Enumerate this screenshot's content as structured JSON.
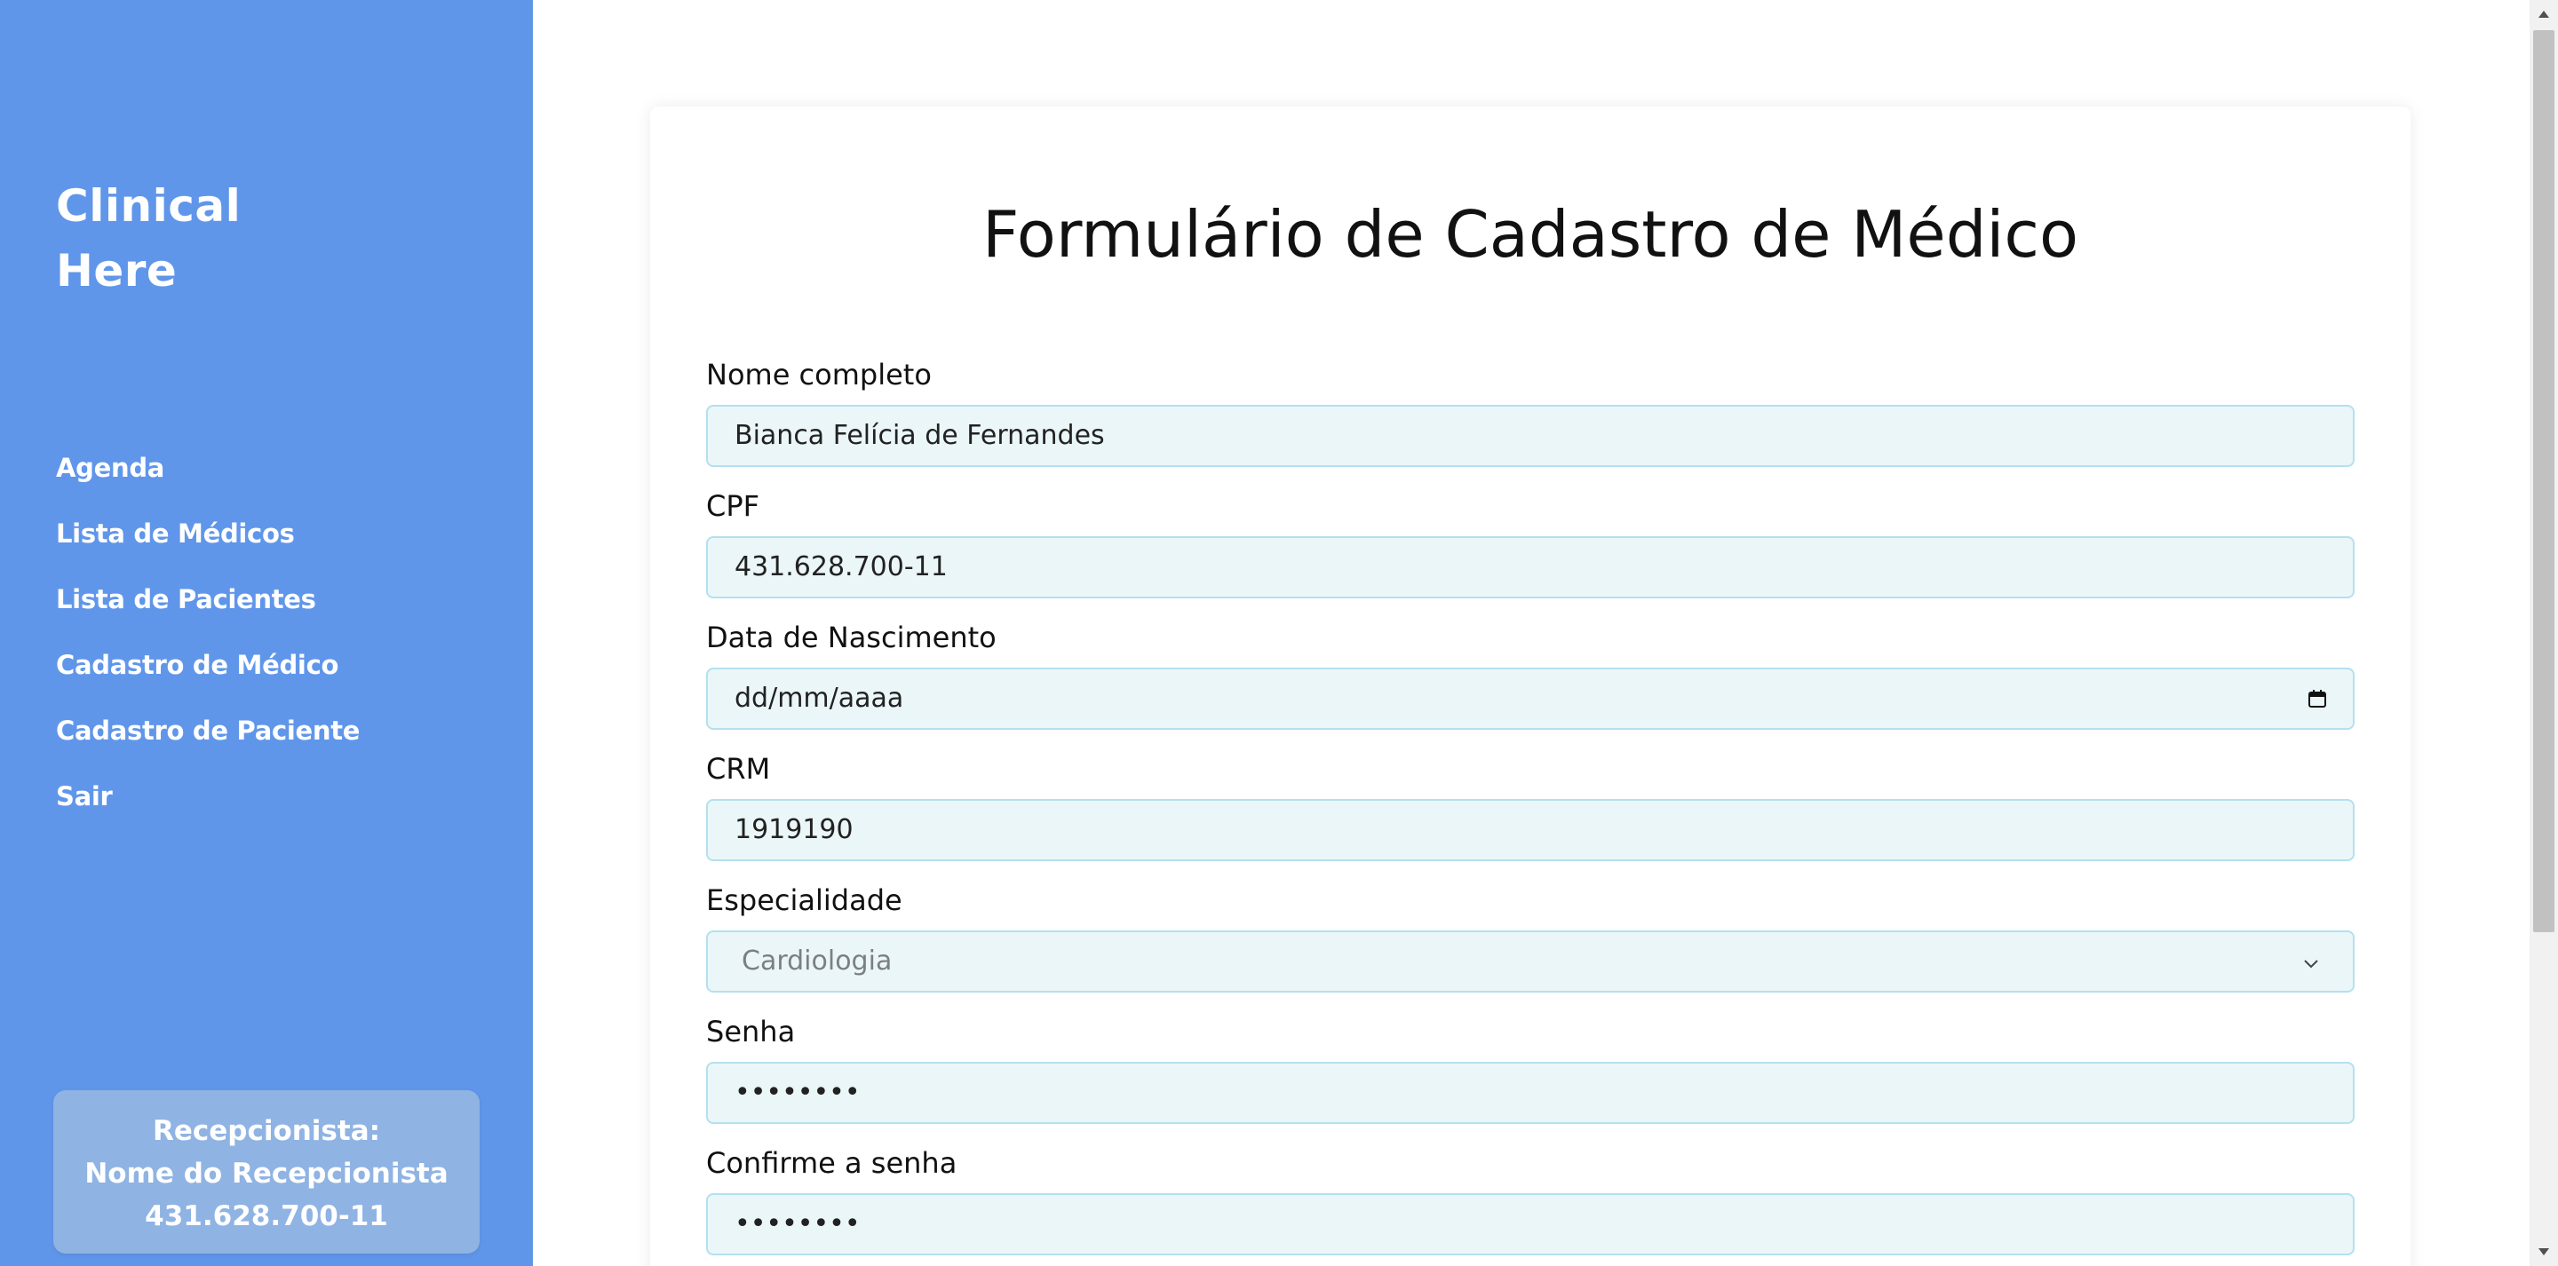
{
  "sidebar": {
    "brand_line1": "Clinical",
    "brand_line2": "Here",
    "nav": [
      {
        "label": "Agenda"
      },
      {
        "label": "Lista de Médicos"
      },
      {
        "label": "Lista de Pacientes"
      },
      {
        "label": "Cadastro de Médico"
      },
      {
        "label": "Cadastro de Paciente"
      },
      {
        "label": "Sair"
      }
    ],
    "user": {
      "role": "Recepcionista:",
      "name": "Nome do Recepcionista",
      "cpf": "431.628.700-11"
    }
  },
  "form": {
    "title": "Formulário de Cadastro de Médico",
    "fields": {
      "nome": {
        "label": "Nome completo",
        "value": "Bianca Felícia de Fernandes"
      },
      "cpf": {
        "label": "CPF",
        "value": "431.628.700-11"
      },
      "nascimento": {
        "label": "Data de Nascimento",
        "value": "dd/mm/aaaa"
      },
      "crm": {
        "label": "CRM",
        "value": "1919190"
      },
      "especialidade": {
        "label": "Especialidade",
        "value": "Cardiologia"
      },
      "senha": {
        "label": "Senha",
        "value": "••••••••"
      },
      "confirme": {
        "label": "Confirme a senha",
        "value": "••••••••"
      }
    }
  },
  "icons": {
    "calendar": "calendar-icon",
    "chevron": "chevron-down-icon",
    "scroll_up": "scroll-up-arrow-icon",
    "scroll_down": "scroll-down-arrow-icon"
  },
  "colors": {
    "sidebar_bg": "#6096ea",
    "input_bg": "#ebf6f8",
    "input_border": "#b4e0ef",
    "user_card_bg": "#8fb3e3"
  }
}
